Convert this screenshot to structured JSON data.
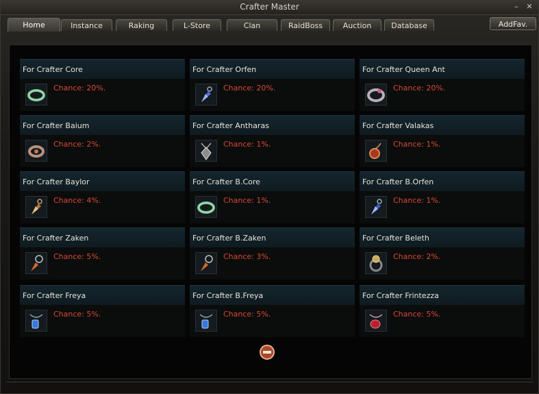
{
  "window": {
    "title": "Crafter Master"
  },
  "tabs": [
    {
      "label": "Home",
      "active": true
    },
    {
      "label": "Instance",
      "active": false
    },
    {
      "label": "Raking",
      "active": false
    },
    {
      "label": "L-Store",
      "active": false
    },
    {
      "label": "Clan",
      "active": false
    },
    {
      "label": "RaidBoss",
      "active": false
    },
    {
      "label": "Auction",
      "active": false
    },
    {
      "label": "Database",
      "active": false
    }
  ],
  "addfav_label": "AddFav.",
  "items": [
    {
      "title": "For Crafter Core",
      "chance": "Chance: 20%.",
      "icon": "belt-icon"
    },
    {
      "title": "For Crafter Orfen",
      "chance": "Chance: 20%.",
      "icon": "earring-icon"
    },
    {
      "title": "For Crafter Queen Ant",
      "chance": "Chance: 20%.",
      "icon": "ring-icon"
    },
    {
      "title": "For Crafter Baium",
      "chance": "Chance: 2%.",
      "icon": "ring-icon"
    },
    {
      "title": "For Crafter Antharas",
      "chance": "Chance: 1%.",
      "icon": "necklace-icon"
    },
    {
      "title": "For Crafter Valakas",
      "chance": "Chance: 1%.",
      "icon": "necklace-icon"
    },
    {
      "title": "For Crafter Baylor",
      "chance": "Chance: 4%.",
      "icon": "earring-icon"
    },
    {
      "title": "For Crafter B.Core",
      "chance": "Chance: 1%.",
      "icon": "belt-icon"
    },
    {
      "title": "For Crafter B.Orfen",
      "chance": "Chance: 1%.",
      "icon": "earring-icon"
    },
    {
      "title": "For Crafter Zaken",
      "chance": "Chance: 5%.",
      "icon": "earring-icon"
    },
    {
      "title": "For Crafter B.Zaken",
      "chance": "Chance: 3%.",
      "icon": "earring-icon"
    },
    {
      "title": "For Crafter Beleth",
      "chance": "Chance: 2%.",
      "icon": "ring-icon"
    },
    {
      "title": "For Crafter Freya",
      "chance": "Chance: 5%.",
      "icon": "necklace-icon"
    },
    {
      "title": "For Crafter B.Freya",
      "chance": "Chance: 5%.",
      "icon": "necklace-icon"
    },
    {
      "title": "For Crafter Frintezza",
      "chance": "Chance: 5%.",
      "icon": "necklace-icon"
    }
  ]
}
